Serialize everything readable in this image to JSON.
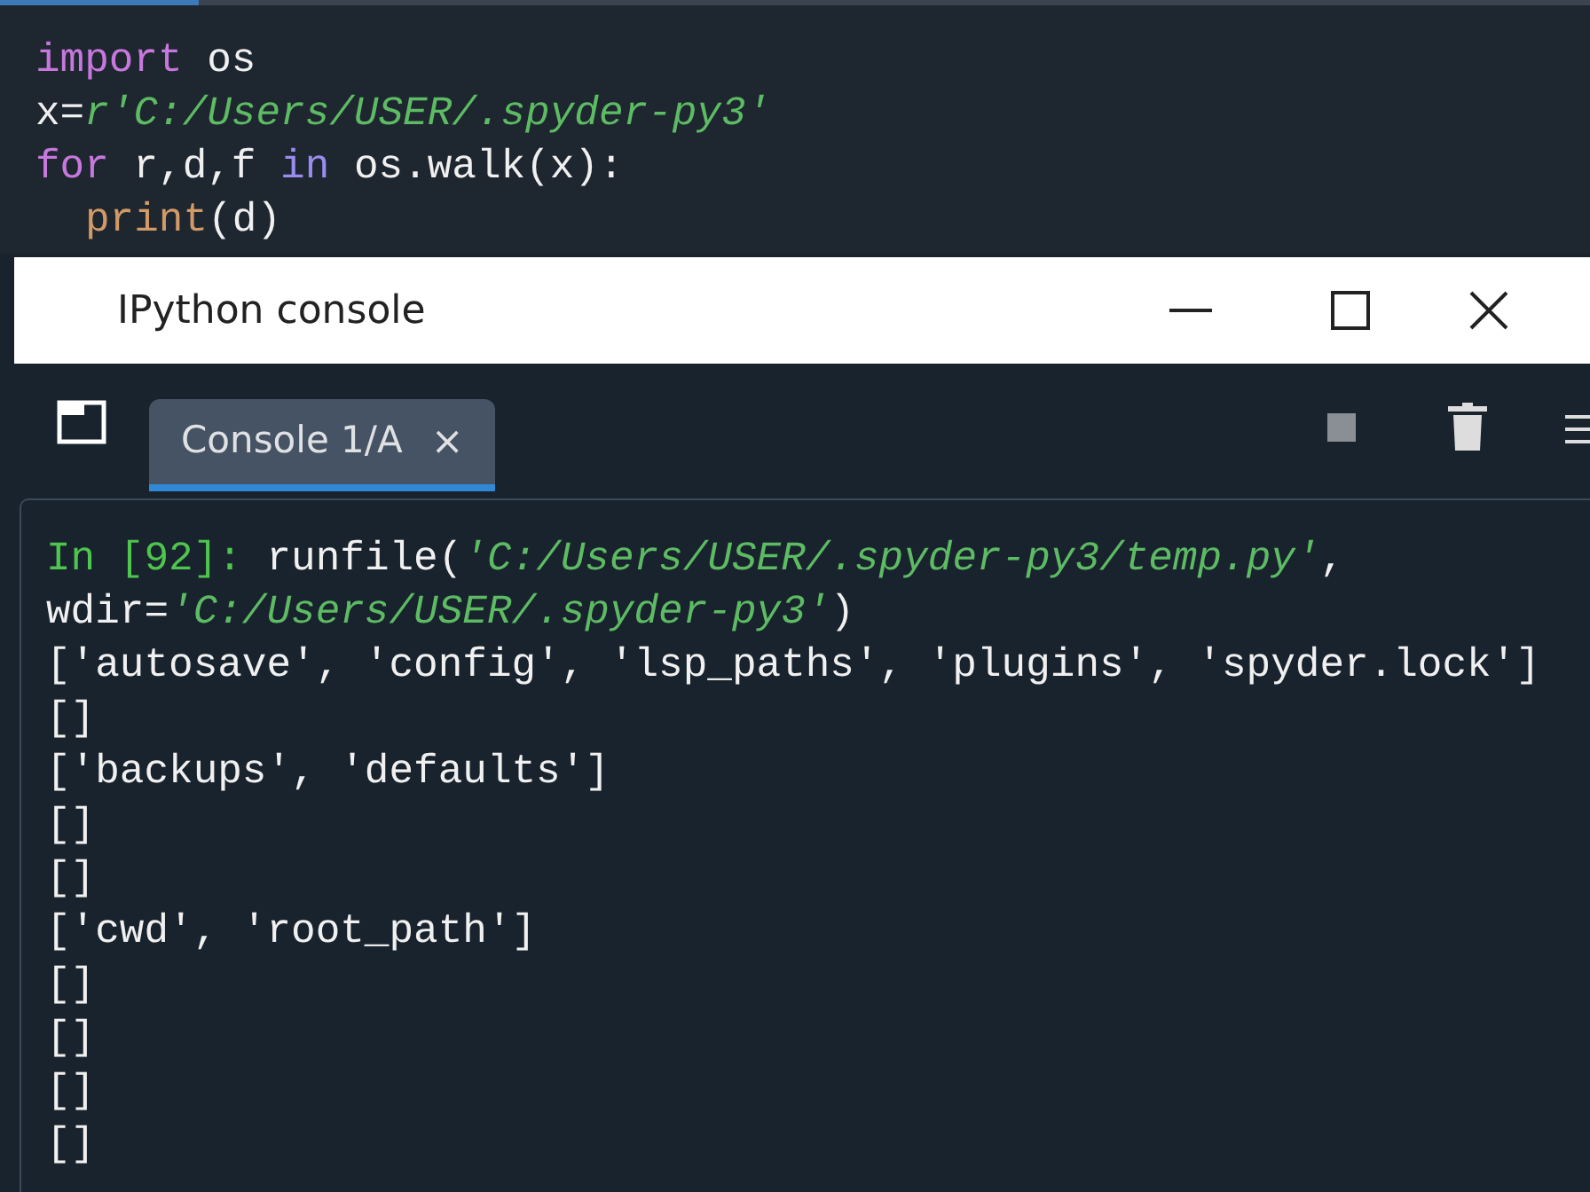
{
  "editor": {
    "lines": [
      [
        {
          "text": "import",
          "kind": "keyword"
        },
        {
          "text": " os",
          "kind": "plain"
        }
      ],
      [
        {
          "text": "x=",
          "kind": "plain"
        },
        {
          "text": "r'C:/Users/USER/.spyder-py3'",
          "kind": "string"
        }
      ],
      {
        "tokens": [
          {
            "text": "for",
            "kind": "keyword"
          },
          {
            "text": " r,d,f ",
            "kind": "plain"
          },
          {
            "text": "in",
            "kind": "operator"
          },
          {
            "text": " os.walk(x):",
            "kind": "plain"
          }
        ],
        "children": [
          [
            {
              "text": "print",
              "kind": "builtin"
            },
            {
              "text": "(d)",
              "kind": "plain"
            }
          ]
        ]
      }
    ]
  },
  "window": {
    "title": "IPython console"
  },
  "tabs": [
    {
      "label": "Console 1/A",
      "selected": true,
      "close": "×"
    }
  ],
  "console": {
    "lines": [
      [
        {
          "text": "In [92]: ",
          "kind": "prompt"
        },
        {
          "text": "runfile(",
          "kind": "plain"
        },
        {
          "text": "'C:/Users/USER/.spyder-py3/temp.py'",
          "kind": "string"
        },
        {
          "text": ",",
          "kind": "plain"
        }
      ],
      [
        {
          "text": "wdir=",
          "kind": "plain"
        },
        {
          "text": "'C:/Users/USER/.spyder-py3'",
          "kind": "string"
        },
        {
          "text": ")",
          "kind": "plain"
        }
      ],
      [
        {
          "text": "['autosave', 'config', 'lsp_paths', 'plugins', 'spyder.lock']",
          "kind": "plain"
        }
      ],
      [
        {
          "text": "[]",
          "kind": "plain"
        }
      ],
      [
        {
          "text": "['backups', 'defaults']",
          "kind": "plain"
        }
      ],
      [
        {
          "text": "[]",
          "kind": "plain"
        }
      ],
      [
        {
          "text": "[]",
          "kind": "plain"
        }
      ],
      [
        {
          "text": "['cwd', 'root_path']",
          "kind": "plain"
        }
      ],
      [
        {
          "text": "[]",
          "kind": "plain"
        }
      ],
      [
        {
          "text": "[]",
          "kind": "plain"
        }
      ],
      [
        {
          "text": "[]",
          "kind": "plain"
        }
      ],
      [
        {
          "text": "[]",
          "kind": "plain"
        }
      ]
    ]
  }
}
